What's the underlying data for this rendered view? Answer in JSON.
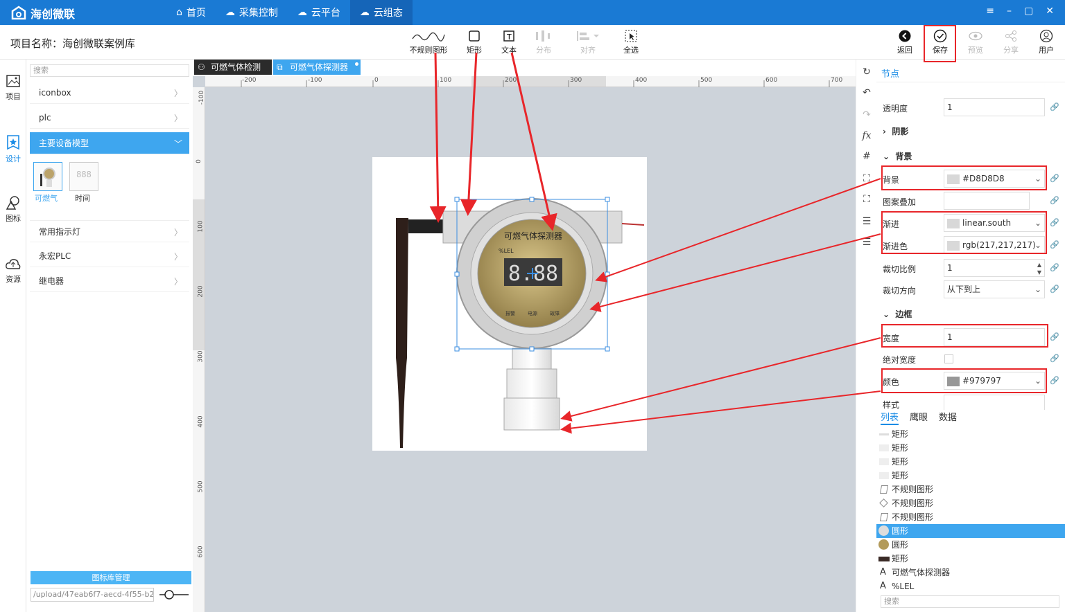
{
  "app": {
    "brand": "海创微联"
  },
  "nav": [
    {
      "label": "首页",
      "icon": "home-icon"
    },
    {
      "label": "采集控制",
      "icon": "cloud-collect-icon"
    },
    {
      "label": "云平台",
      "icon": "cloud-platform-icon"
    },
    {
      "label": "云组态",
      "icon": "cloud-config-icon"
    }
  ],
  "window": {
    "menu": "≡",
    "minimize": "–",
    "maximize": "▢",
    "close": "✕"
  },
  "project": {
    "name": "项目名称：海创微联案例库"
  },
  "toolbar": [
    {
      "label": "不规则图形",
      "icon": "irregular-shape-icon",
      "enabled": true
    },
    {
      "label": "矩形",
      "icon": "rectangle-icon",
      "enabled": true
    },
    {
      "label": "文本",
      "icon": "text-icon",
      "enabled": true
    },
    {
      "label": "分布",
      "icon": "distribute-icon",
      "enabled": false
    },
    {
      "label": "对齐",
      "icon": "align-icon",
      "enabled": false
    },
    {
      "label": "全选",
      "icon": "select-all-icon",
      "enabled": true
    }
  ],
  "actions": [
    {
      "label": "返回",
      "icon": "back-icon",
      "enabled": true
    },
    {
      "label": "保存",
      "icon": "save-check-icon",
      "enabled": true
    },
    {
      "label": "预览",
      "icon": "preview-eye-icon",
      "enabled": false
    },
    {
      "label": "分享",
      "icon": "share-icon",
      "enabled": false
    },
    {
      "label": "用户",
      "icon": "user-icon",
      "enabled": true
    }
  ],
  "rail": [
    {
      "label": "项目",
      "icon": "project-image-icon"
    },
    {
      "label": "设计",
      "icon": "design-star-icon"
    },
    {
      "label": "图标",
      "icon": "shapes-icon"
    },
    {
      "label": "资源",
      "icon": "upload-cloud-icon"
    }
  ],
  "library": {
    "search_placeholder": "搜索",
    "groups_top": [
      "iconbox",
      "plc"
    ],
    "active_group": "主要设备模型",
    "thumbs": [
      {
        "label": "可燃气"
      },
      {
        "label": "时间"
      }
    ],
    "thumb_time_text": "888",
    "groups_bottom": [
      "常用指示灯",
      "永宏PLC",
      "继电器"
    ],
    "footer": "图标库管理",
    "path": "/upload/47eab6f7-aecd-4f55-b29"
  },
  "tabs": [
    {
      "label": "可燃气体检测",
      "close": "×"
    },
    {
      "label": "可燃气体探测器"
    }
  ],
  "ruler": {
    "h": [
      "-200",
      "-100",
      "0",
      "100",
      "200",
      "300",
      "400",
      "500",
      "600",
      "700"
    ],
    "v": [
      "-100",
      "0",
      "100",
      "200",
      "300",
      "400",
      "500",
      "600"
    ]
  },
  "device": {
    "title": "可燃气体探测器",
    "unit": "%LEL",
    "display": "8.88",
    "labels": [
      "报警",
      "电源",
      "故障"
    ]
  },
  "sidetools": [
    "↻",
    "↶",
    "↷",
    "fx",
    "#",
    "⛶",
    "⛶",
    "☰",
    "☰"
  ],
  "props": {
    "title": "节点",
    "opacity": {
      "label": "透明度",
      "value": "1"
    },
    "shadow": "阴影",
    "background_section": "背景",
    "background": {
      "label": "背景",
      "value": "#D8D8D8",
      "color": "#D8D8D8"
    },
    "pattern": {
      "label": "图案叠加",
      "value": ""
    },
    "gradient": {
      "label": "渐进",
      "value": "linear.south",
      "color": "#D8D8D8"
    },
    "gradient_color": {
      "label": "渐进色",
      "value": "rgb(217,217,217)",
      "color": "#D9D9D9"
    },
    "clip_ratio": {
      "label": "裁切比例",
      "value": "1"
    },
    "clip_dir": {
      "label": "裁切方向",
      "value": "从下到上"
    },
    "border_section": "边框",
    "width": {
      "label": "宽度",
      "value": "1"
    },
    "abs_width": {
      "label": "绝对宽度"
    },
    "color": {
      "label": "颜色",
      "value": "#979797",
      "color": "#979797"
    },
    "style": {
      "label": "样式"
    }
  },
  "bottom": {
    "tabs": [
      "列表",
      "鹰眼",
      "数据"
    ],
    "items": [
      {
        "label": "矩形",
        "icon": "rect-light-icon"
      },
      {
        "label": "矩形",
        "icon": "rect-light-icon"
      },
      {
        "label": "矩形",
        "icon": "rect-light-icon"
      },
      {
        "label": "矩形",
        "icon": "rect-light-icon"
      },
      {
        "label": "不规则图形",
        "icon": "irregular-icon"
      },
      {
        "label": "不规则图形",
        "icon": "irregular-icon"
      },
      {
        "label": "不规则图形",
        "icon": "irregular-icon"
      },
      {
        "label": "圆形",
        "icon": "circle-gray-icon"
      },
      {
        "label": "圆形",
        "icon": "circle-gold-icon"
      },
      {
        "label": "矩形",
        "icon": "rect-dark-icon"
      },
      {
        "label": "可燃气体探测器",
        "icon": "text-a-icon"
      },
      {
        "label": "%LEL",
        "icon": "text-a-icon"
      }
    ],
    "search_placeholder": "搜索"
  },
  "colors": {
    "accent": "#1a7ad4",
    "active": "#3ea6ef",
    "highlight_red": "#e8262a"
  }
}
